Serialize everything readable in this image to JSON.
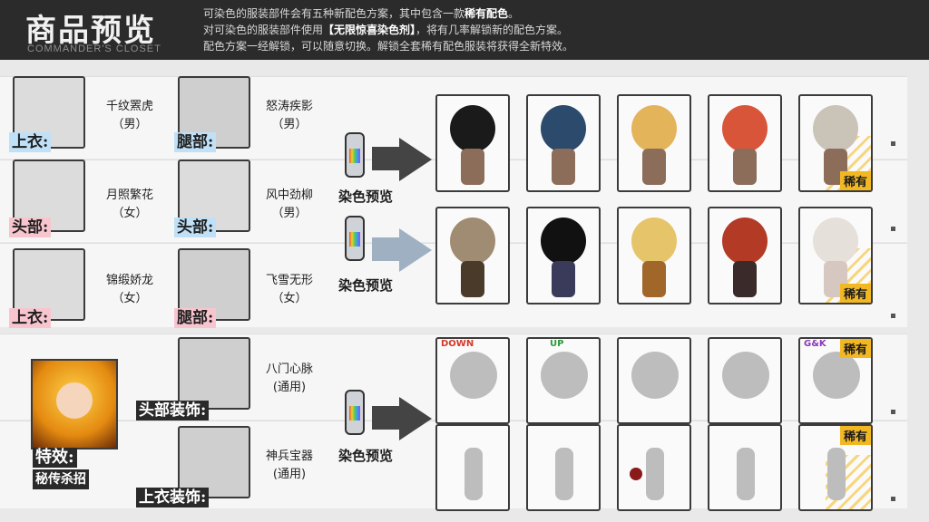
{
  "header": {
    "title": "商品预览",
    "subtitle": "COMMANDER'S CLOSET",
    "lines": [
      "可染色的服装部件会有五种新配色方案，其中包含一款",
      "稀有配色",
      "。",
      "对可染色的服装部件使用",
      "【无限惊喜染色剂】",
      "，将有几率解锁新的配色方案。",
      "配色方案一经解锁，可以随意切换。解锁全套稀有配色服装将获得全新特效。"
    ]
  },
  "rows": [
    {
      "tag": "上衣:",
      "name": "千纹罴虎",
      "sub": "（男）",
      "tag2": "腿部:",
      "name2": "怒涛疾影",
      "sub2": "（男）"
    },
    {
      "tag": "头部:",
      "name": "月照繁花",
      "sub": "（女）",
      "tag2": "头部:",
      "name2": "风中劲柳",
      "sub2": "（男）"
    },
    {
      "tag": "上衣:",
      "name": "锦缎娇龙",
      "sub": "（女）",
      "tag2": "腿部:",
      "name2": "飞雪无形",
      "sub2": "（女）"
    },
    {
      "tag2": "头部装饰:",
      "name2": "八门心脉",
      "sub2": "(通用)"
    },
    {
      "tag2": "上衣装饰:",
      "name2": "神兵宝器",
      "sub2": "(通用)"
    }
  ],
  "dye_label": "染色预览",
  "rare_label": "稀有",
  "special": {
    "tag": "特效:",
    "name": "秘传杀招"
  },
  "accessory_texts": [
    "DOWN",
    "UP",
    "G&K"
  ],
  "colors": {
    "male_hair": [
      "#1a1a1a",
      "#2c4a6b",
      "#e3b45a",
      "#d9553a",
      "#c9c3b8"
    ],
    "female_hair": [
      "#a08b73",
      "#111111",
      "#e6c46a",
      "#b33a25",
      "#e6e0da"
    ],
    "rare": "#f2b824"
  }
}
